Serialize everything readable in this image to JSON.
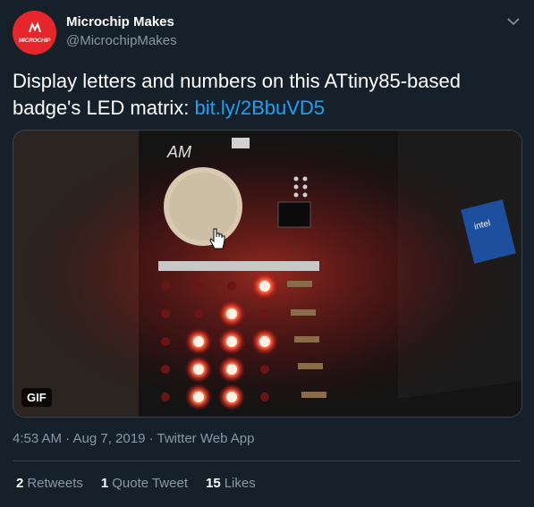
{
  "author": {
    "name": "Microchip Makes",
    "handle": "@MicrochipMakes",
    "avatar_text": "MICROCHIP"
  },
  "tweet": {
    "text": "Display letters and numbers on this ATtiny85-based badge's LED matrix: ",
    "link": "bit.ly/2BbuVD5",
    "media_badge": "GIF",
    "media_board_label": "AM",
    "timestamp": "4:53 AM · Aug 7, 2019 · Twitter Web App"
  },
  "stats": [
    {
      "count": "2",
      "label": "Retweets"
    },
    {
      "count": "1",
      "label": "Quote Tweet"
    },
    {
      "count": "15",
      "label": "Likes"
    }
  ],
  "led_matrix": {
    "rows": 5,
    "cols": 4,
    "lit": [
      [
        0,
        3
      ],
      [
        1,
        2
      ],
      [
        2,
        1
      ],
      [
        2,
        2
      ],
      [
        2,
        3
      ],
      [
        3,
        1
      ],
      [
        3,
        2
      ],
      [
        4,
        1
      ],
      [
        4,
        2
      ]
    ]
  },
  "colors": {
    "background": "#15202b",
    "link": "#1da1f2",
    "secondary_text": "#8899a6",
    "divider": "#38444d",
    "brand_red": "#e5262b"
  },
  "icons": {
    "caret": "chevron-down-icon",
    "cursor": "hand-cursor-icon"
  }
}
